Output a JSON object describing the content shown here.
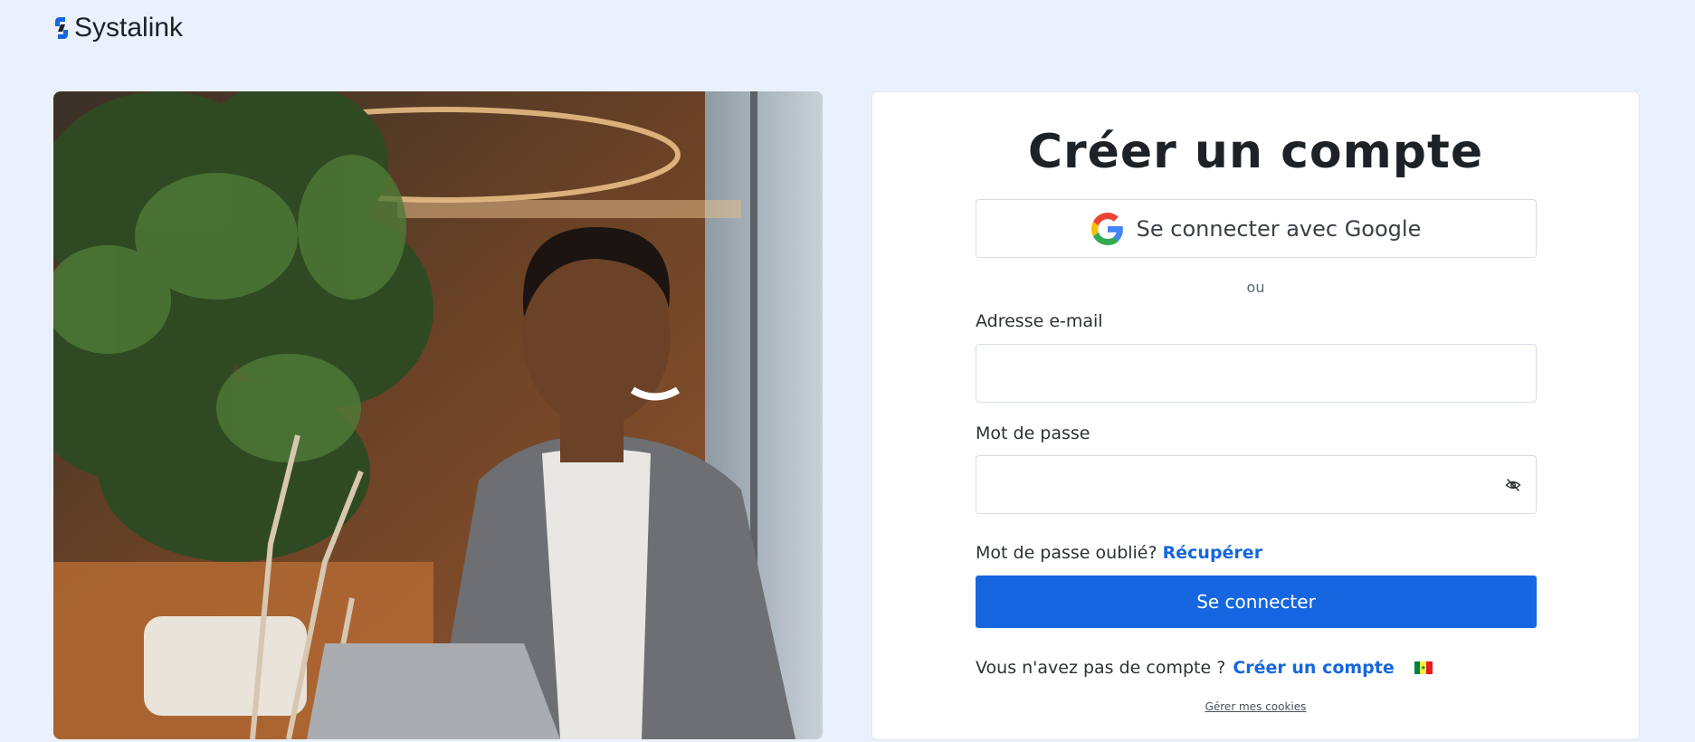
{
  "brand": {
    "name": "Systalink",
    "logo_icon": "systalink-logo-icon",
    "accent": "#1566e0"
  },
  "hero": {
    "image": "woman-smiling-office-photo"
  },
  "form": {
    "title": "Créer un compte",
    "google_button": "Se connecter avec Google",
    "google_icon": "google-icon",
    "separator": "ou",
    "email_label": "Adresse e-mail",
    "email_value": "",
    "password_label": "Mot de passe",
    "password_value": "",
    "password_toggle_icon": "eye-off-icon",
    "forgot_text": "Mot de passe oublié?",
    "forgot_link": "Récupérer",
    "submit_button": "Se connecter",
    "signup_text": "Vous n'avez pas de compte ?",
    "signup_link": "Créer un compte",
    "language_icon": "senegal-flag-icon",
    "cookies_link": "Gérer mes cookies"
  }
}
